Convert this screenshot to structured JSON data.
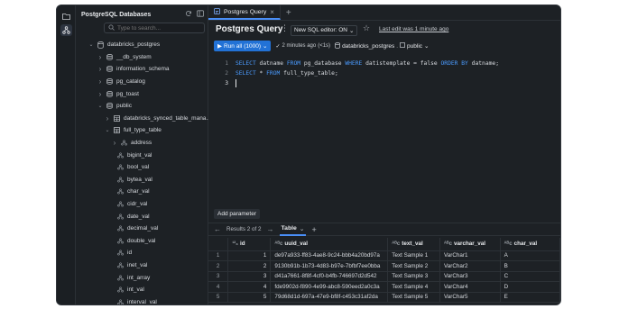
{
  "sidebar": {
    "title": "PostgreSQL Databases",
    "search_placeholder": "Type to search...",
    "tree": [
      {
        "label": "databricks_postgres",
        "icon": "database-icon",
        "expanded": true,
        "level": 0
      },
      {
        "label": "__db_system",
        "icon": "schema-icon",
        "expanded": false,
        "level": 1
      },
      {
        "label": "information_schema",
        "icon": "schema-icon",
        "expanded": false,
        "level": 1
      },
      {
        "label": "pg_catalog",
        "icon": "schema-icon",
        "expanded": false,
        "level": 1
      },
      {
        "label": "pg_toast",
        "icon": "schema-icon",
        "expanded": false,
        "level": 1
      },
      {
        "label": "public",
        "icon": "schema-icon",
        "expanded": true,
        "level": 1
      },
      {
        "label": "databricks_synced_table_mana...",
        "icon": "table-icon",
        "expanded": false,
        "level": 2
      },
      {
        "label": "full_type_table",
        "icon": "table-icon",
        "expanded": true,
        "level": 2
      },
      {
        "label": "address",
        "icon": "column-icon",
        "expanded": false,
        "level": 3
      },
      {
        "label": "bigint_val",
        "icon": "column-icon",
        "level": 4
      },
      {
        "label": "bool_val",
        "icon": "column-icon",
        "level": 4
      },
      {
        "label": "bytea_val",
        "icon": "column-icon",
        "level": 4
      },
      {
        "label": "char_val",
        "icon": "column-icon",
        "level": 4
      },
      {
        "label": "cidr_val",
        "icon": "column-icon",
        "level": 4
      },
      {
        "label": "date_val",
        "icon": "column-icon",
        "level": 4
      },
      {
        "label": "decimal_val",
        "icon": "column-icon",
        "level": 4
      },
      {
        "label": "double_val",
        "icon": "column-icon",
        "level": 4
      },
      {
        "label": "id",
        "icon": "column-icon",
        "level": 4
      },
      {
        "label": "inet_val",
        "icon": "column-icon",
        "level": 4
      },
      {
        "label": "int_array",
        "icon": "column-icon",
        "level": 4
      },
      {
        "label": "int_val",
        "icon": "column-icon",
        "level": 4
      },
      {
        "label": "interval_val",
        "icon": "column-icon",
        "level": 4
      }
    ]
  },
  "tabs": {
    "active_label": "Postgres Query",
    "close": "×",
    "add": "+"
  },
  "header": {
    "title": "Postgres Query",
    "sql_editor": "New SQL editor: ON",
    "last_edit": "Last edit was 1 minute ago"
  },
  "toolbar": {
    "run_label": "Run all",
    "run_limit": "(1000)",
    "status_time": "2 minutes ago",
    "status_duration": "(<1s)",
    "catalog": "databricks_postgres",
    "schema": "public"
  },
  "editor": {
    "lines": [
      {
        "num": "1"
      },
      {
        "num": "2"
      },
      {
        "num": "3"
      }
    ],
    "line1": {
      "kw1": "SELECT",
      "t1": " datname ",
      "kw2": "FROM",
      "t2": " pg_database ",
      "kw3": "WHERE",
      "t3": " datistemplate = false ",
      "kw4": "ORDER BY",
      "t4": " datname;"
    },
    "line2": {
      "kw1": "SELECT",
      "t1": " * ",
      "kw2": "FROM",
      "t2": " full_type_table;"
    }
  },
  "add_parameter": "Add parameter",
  "results": {
    "nav_label": "Results 2 of 2",
    "tab_label": "Table",
    "add": "+",
    "columns": [
      "id",
      "uuid_val",
      "text_val",
      "varchar_val",
      "char_val"
    ],
    "rows": [
      [
        "1",
        "1",
        "de97a933-ff83-4ae8-9c24-bbb4a20bd97a",
        "Text Sample 1",
        "VarChar1",
        "A"
      ],
      [
        "2",
        "2",
        "9130b91b-1b73-4d83-b97e-7bfbf7ee0bba",
        "Text Sample 2",
        "VarChar2",
        "B"
      ],
      [
        "3",
        "3",
        "d41a7661-8f8f-4cf0-b4fb-746697d2d542",
        "Text Sample 3",
        "VarChar3",
        "C"
      ],
      [
        "4",
        "4",
        "fde9902d-f890-4e99-abc8-590eed2a0c3a",
        "Text Sample 4",
        "VarChar4",
        "D"
      ],
      [
        "5",
        "5",
        "79d68d1d-697a-47e9-bf8f-c453c31af2da",
        "Text Sample 5",
        "VarChar5",
        "E"
      ]
    ]
  },
  "colors": {
    "accent": "#2272d6",
    "keyword": "#4a9bff",
    "background": "#1d2125"
  }
}
